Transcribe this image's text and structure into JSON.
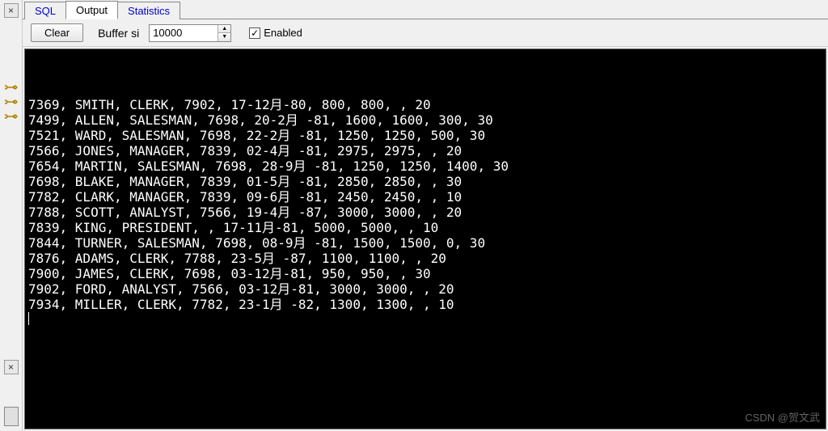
{
  "tabs": {
    "sql": "SQL",
    "output": "Output",
    "statistics": "Statistics"
  },
  "toolbar": {
    "clear_label": "Clear",
    "buffer_label": "Buffer si",
    "buffer_value": "10000",
    "enabled_label": "Enabled",
    "enabled_checked": "✓"
  },
  "close_x": "×",
  "output_rows": [
    "7369, SMITH, CLERK, 7902, 17-12月-80, 800, 800, , 20",
    "7499, ALLEN, SALESMAN, 7698, 20-2月 -81, 1600, 1600, 300, 30",
    "7521, WARD, SALESMAN, 7698, 22-2月 -81, 1250, 1250, 500, 30",
    "7566, JONES, MANAGER, 7839, 02-4月 -81, 2975, 2975, , 20",
    "7654, MARTIN, SALESMAN, 7698, 28-9月 -81, 1250, 1250, 1400, 30",
    "7698, BLAKE, MANAGER, 7839, 01-5月 -81, 2850, 2850, , 30",
    "7782, CLARK, MANAGER, 7839, 09-6月 -81, 2450, 2450, , 10",
    "7788, SCOTT, ANALYST, 7566, 19-4月 -87, 3000, 3000, , 20",
    "7839, KING, PRESIDENT, , 17-11月-81, 5000, 5000, , 10",
    "7844, TURNER, SALESMAN, 7698, 08-9月 -81, 1500, 1500, 0, 30",
    "7876, ADAMS, CLERK, 7788, 23-5月 -87, 1100, 1100, , 20",
    "7900, JAMES, CLERK, 7698, 03-12月-81, 950, 950, , 30",
    "7902, FORD, ANALYST, 7566, 03-12月-81, 3000, 3000, , 20",
    "7934, MILLER, CLERK, 7782, 23-1月 -82, 1300, 1300, , 10"
  ],
  "watermark": "CSDN @贺文武"
}
